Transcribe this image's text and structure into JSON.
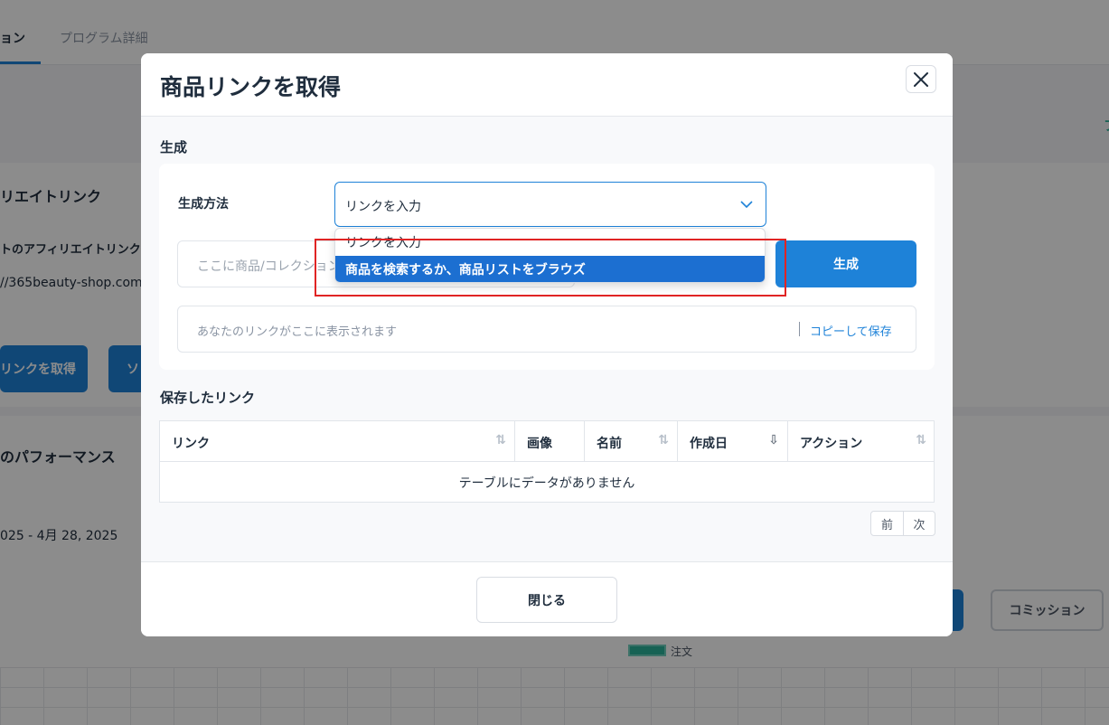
{
  "background": {
    "tabs": [
      "ョン",
      "プログラム詳細"
    ],
    "affiliate_link_title": "リエイトリンク",
    "affiliate_subtitle": "トのアフィリエイトリンク",
    "shop_url": "//365beauty-shop.com",
    "get_link_button": "リンクを取得",
    "second_button": "ソ",
    "performance_title": "のパフォーマンス",
    "date_range": "025 - 4月 28, 2025",
    "commission_button": "コミッション",
    "legend_label": "注文",
    "right_edge_text": "フ"
  },
  "modal": {
    "title": "商品リンクを取得",
    "generate_section": "生成",
    "method_label": "生成方法",
    "select_value": "リンクを入力",
    "dropdown_options": [
      "リンクを入力",
      "商品を検索するか、商品リストをブラウズ"
    ],
    "url_placeholder": "ここに商品/コレクション",
    "generate_button": "生成",
    "result_placeholder": "あなたのリンクがここに表示されます",
    "copy_save": "コピーして保存",
    "saved_links_section": "保存したリンク",
    "table": {
      "columns": [
        "リンク",
        "画像",
        "名前",
        "作成日",
        "アクション"
      ],
      "empty_message": "テーブルにデータがありません"
    },
    "pager": {
      "prev": "前",
      "next": "次"
    },
    "close_button": "閉じる"
  },
  "colors": {
    "accent": "#1e82d8",
    "highlight": "#e02424",
    "selected": "#1c6fd1"
  }
}
